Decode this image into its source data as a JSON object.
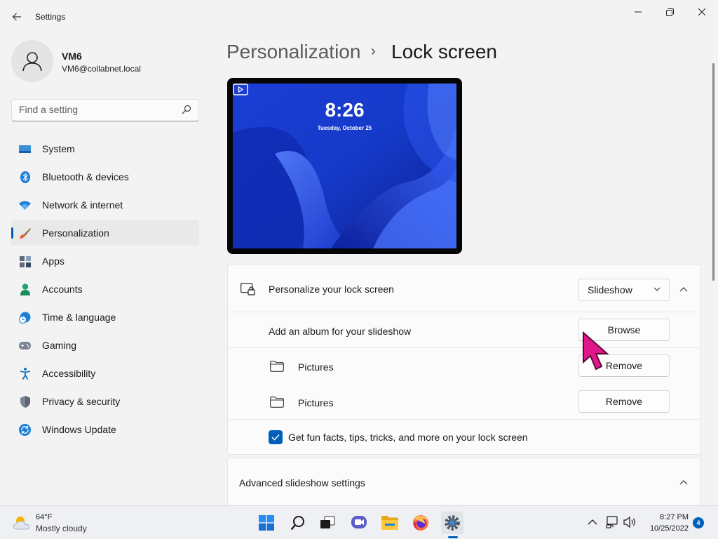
{
  "window": {
    "title": "Settings",
    "back_icon": "back-arrow-icon",
    "minimize_glyph": "—",
    "maximize_glyph": "❐",
    "close_glyph": "✕"
  },
  "user": {
    "name": "VM6",
    "email": "VM6@collabnet.local"
  },
  "search": {
    "placeholder": "Find a setting"
  },
  "sidebar": {
    "items": [
      {
        "label": "System",
        "icon": "system-icon",
        "active": false
      },
      {
        "label": "Bluetooth & devices",
        "icon": "bluetooth-icon",
        "active": false
      },
      {
        "label": "Network & internet",
        "icon": "wifi-icon",
        "active": false
      },
      {
        "label": "Personalization",
        "icon": "paintbrush-icon",
        "active": true
      },
      {
        "label": "Apps",
        "icon": "apps-icon",
        "active": false
      },
      {
        "label": "Accounts",
        "icon": "accounts-icon",
        "active": false
      },
      {
        "label": "Time & language",
        "icon": "time-language-icon",
        "active": false
      },
      {
        "label": "Gaming",
        "icon": "gamepad-icon",
        "active": false
      },
      {
        "label": "Accessibility",
        "icon": "accessibility-icon",
        "active": false
      },
      {
        "label": "Privacy & security",
        "icon": "shield-icon",
        "active": false
      },
      {
        "label": "Windows Update",
        "icon": "windows-update-icon",
        "active": false
      }
    ]
  },
  "breadcrumb": {
    "parent": "Personalization",
    "separator": "›",
    "current": "Lock screen"
  },
  "preview": {
    "time": "8:26",
    "date": "Tuesday, October 25"
  },
  "lock_screen": {
    "personalize_label": "Personalize your lock screen",
    "mode_value": "Slideshow",
    "add_album_label": "Add an album for your slideshow",
    "browse_label": "Browse",
    "albums": [
      {
        "name": "Pictures",
        "remove_label": "Remove"
      },
      {
        "name": "Pictures",
        "remove_label": "Remove"
      }
    ],
    "fun_facts_label": "Get fun facts, tips, tricks, and more on your lock screen",
    "fun_facts_checked": true
  },
  "advanced": {
    "label": "Advanced slideshow settings"
  },
  "taskbar": {
    "weather_temp": "64°F",
    "weather_desc": "Mostly cloudy",
    "time": "8:27 PM",
    "date": "10/25/2022",
    "notification_count": "4",
    "apps": [
      "start-icon",
      "search-icon",
      "task-view-icon",
      "chat-icon",
      "file-explorer-icon",
      "firefox-icon",
      "settings-icon"
    ]
  },
  "colors": {
    "accent": "#005fb8",
    "cursor": "#e0168a"
  }
}
